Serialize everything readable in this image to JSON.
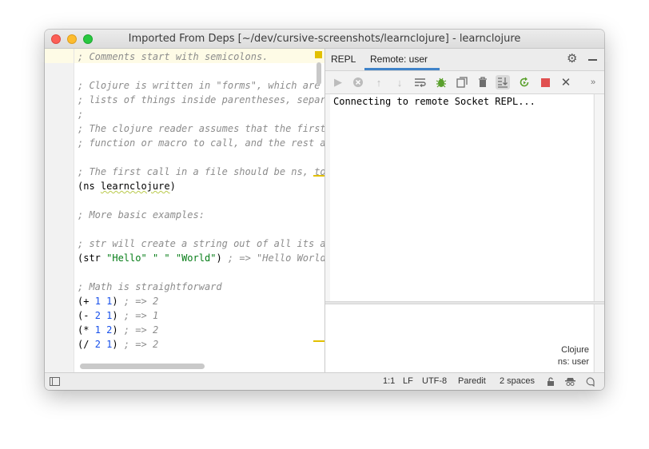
{
  "window": {
    "title": "Imported From Deps [~/dev/cursive-screenshots/learnclojure] - learnclojure"
  },
  "editor": {
    "lines": [
      [
        {
          "t": "; Comments start with semicolons.",
          "c": "cmt"
        }
      ],
      [],
      [
        {
          "t": "; Clojure is written in \"forms\", which are j",
          "c": "cmt"
        }
      ],
      [
        {
          "t": "; lists of things inside parentheses, separa",
          "c": "cmt"
        }
      ],
      [
        {
          "t": ";",
          "c": "cmt"
        }
      ],
      [
        {
          "t": "; The clojure reader assumes that the first ",
          "c": "cmt"
        }
      ],
      [
        {
          "t": "; function or macro to call, and the rest ar",
          "c": "cmt"
        }
      ],
      [],
      [
        {
          "t": "; The first call in a file should be ns, to ",
          "c": "cmt"
        }
      ],
      [
        {
          "t": "(ns ",
          "c": ""
        },
        {
          "t": "learnclojure",
          "c": "squig"
        },
        {
          "t": ")",
          "c": ""
        }
      ],
      [],
      [
        {
          "t": "; More basic examples:",
          "c": "cmt"
        }
      ],
      [],
      [
        {
          "t": "; str will create a string out of all its ar",
          "c": "cmt"
        }
      ],
      [
        {
          "t": "(str ",
          "c": ""
        },
        {
          "t": "\"Hello\"",
          "c": "str"
        },
        {
          "t": " ",
          "c": ""
        },
        {
          "t": "\" \"",
          "c": "str"
        },
        {
          "t": " ",
          "c": ""
        },
        {
          "t": "\"World\"",
          "c": "str"
        },
        {
          "t": ") ",
          "c": ""
        },
        {
          "t": "; => \"Hello World\"",
          "c": "cmt"
        }
      ],
      [],
      [
        {
          "t": "; Math is straightforward",
          "c": "cmt"
        }
      ],
      [
        {
          "t": "(+ ",
          "c": ""
        },
        {
          "t": "1",
          "c": "num"
        },
        {
          "t": " ",
          "c": ""
        },
        {
          "t": "1",
          "c": "num"
        },
        {
          "t": ") ",
          "c": ""
        },
        {
          "t": "; => 2",
          "c": "cmt"
        }
      ],
      [
        {
          "t": "(- ",
          "c": ""
        },
        {
          "t": "2",
          "c": "num"
        },
        {
          "t": " ",
          "c": ""
        },
        {
          "t": "1",
          "c": "num"
        },
        {
          "t": ") ",
          "c": ""
        },
        {
          "t": "; => 1",
          "c": "cmt"
        }
      ],
      [
        {
          "t": "(* ",
          "c": ""
        },
        {
          "t": "1",
          "c": "num"
        },
        {
          "t": " ",
          "c": ""
        },
        {
          "t": "2",
          "c": "num"
        },
        {
          "t": ") ",
          "c": ""
        },
        {
          "t": "; => 2",
          "c": "cmt"
        }
      ],
      [
        {
          "t": "(/ ",
          "c": ""
        },
        {
          "t": "2",
          "c": "num"
        },
        {
          "t": " ",
          "c": ""
        },
        {
          "t": "1",
          "c": "num"
        },
        {
          "t": ") ",
          "c": ""
        },
        {
          "t": "; => 2",
          "c": "cmt"
        }
      ]
    ]
  },
  "repl": {
    "tabs": [
      "REPL",
      "Remote: user"
    ],
    "toolbar_icons": [
      "run-icon",
      "stop-circle-icon",
      "up-arrow-icon",
      "down-arrow-icon",
      "soft-wrap-icon",
      "debug-icon",
      "copy-icon",
      "trash-icon",
      "scroll-to-end-icon",
      "rerun-icon",
      "stop-icon",
      "close-icon",
      "more-icon"
    ],
    "output": "Connecting to remote Socket REPL...",
    "language": "Clojure",
    "namespace": "ns: user"
  },
  "status_bar": {
    "position": "1:1",
    "line_separator": "LF",
    "encoding": "UTF-8",
    "mode": "Paredit",
    "indent": "2 spaces"
  },
  "colors": {
    "accent": "#4083c9",
    "current_line": "#fefbe6",
    "warning_stripe": "#e2c000",
    "stop_red": "#e05050",
    "debug_green": "#5aa02c"
  }
}
